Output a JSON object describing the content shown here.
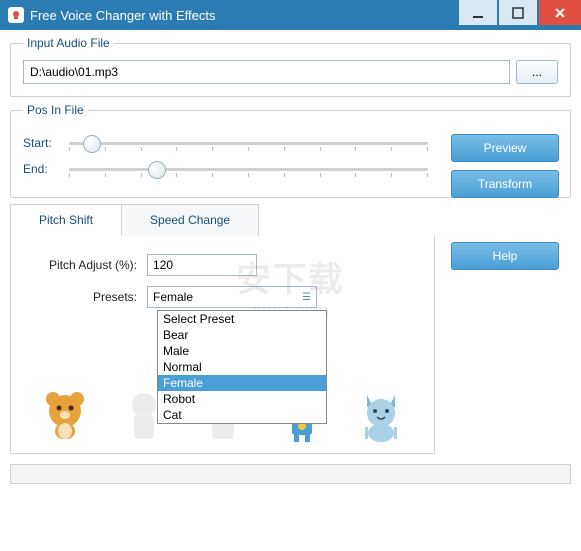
{
  "titlebar": {
    "title": "Free Voice Changer with Effects"
  },
  "input_section": {
    "legend": "Input Audio File",
    "path": "D:\\audio\\01.mp3",
    "browse": "..."
  },
  "pos_section": {
    "legend": "Pos In File",
    "start_label": "Start:",
    "end_label": "End:",
    "start_pos_pct": 4,
    "end_pos_pct": 22
  },
  "buttons": {
    "preview": "Preview",
    "transform": "Transform",
    "help": "Help"
  },
  "tabs": {
    "pitch": "Pitch Shift",
    "speed": "Speed Change"
  },
  "pitch_tab": {
    "adjust_label": "Pitch Adjust (%):",
    "adjust_value": "120",
    "presets_label": "Presets:",
    "preset_value": "Female",
    "options": [
      "Select Preset",
      "Bear",
      "Male",
      "Normal",
      "Female",
      "Robot",
      "Cat"
    ],
    "selected_index": 4
  },
  "watermark": {
    "line1": "安下载",
    "line2": "anxz.com"
  }
}
